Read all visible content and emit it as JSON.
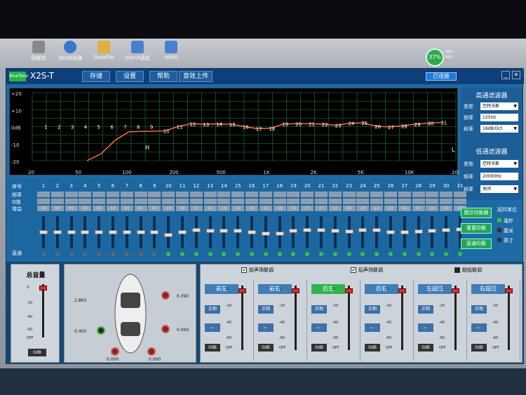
{
  "app": {
    "title": "X2S-T",
    "logo": "BlueTone",
    "connection": "已连接"
  },
  "menu": [
    "存储",
    "设置",
    "帮助",
    "音效上传"
  ],
  "desktop": {
    "icons": [
      "回收站",
      "360浏览器",
      "DataFile",
      "DSP-P调试",
      "H860"
    ],
    "battery": "37%",
    "net_up": "0K/s",
    "net_down": "0K/s"
  },
  "graph": {
    "y_labels": [
      "+20",
      "+10",
      "0dB",
      "-10",
      "-20"
    ],
    "x_labels": [
      "20",
      "50",
      "100",
      "200",
      "500",
      "1K",
      "2K",
      "5K",
      "10K",
      "20K"
    ],
    "marker_h": "H",
    "marker_l": "L"
  },
  "band_numbers": [
    "1",
    "2",
    "3",
    "4",
    "5",
    "6",
    "7",
    "8",
    "9",
    "10",
    "11",
    "12",
    "13",
    "14",
    "15",
    "16",
    "17",
    "18",
    "19",
    "20",
    "21",
    "22",
    "23",
    "24",
    "25",
    "26",
    "27",
    "28",
    "29",
    "30",
    "31"
  ],
  "band_gains": [
    0,
    0,
    0,
    0,
    0,
    0,
    0,
    0,
    0,
    -2.5,
    0.0,
    1.7,
    1.4,
    1.6,
    1.4,
    0.1,
    -1.2,
    -1.0,
    1.6,
    1.7,
    1.7,
    1.5,
    0.8,
    2.0,
    2.2,
    0.3,
    -0.2,
    0.5,
    1.5,
    2.0,
    2.5
  ],
  "rows": {
    "seq": "序号",
    "freq": "频率",
    "q": "Q值",
    "gain": "增益",
    "direct": "直通"
  },
  "high_filter": {
    "title": "高通滤波器",
    "type_label": "类型",
    "type": "巴特沃斯",
    "freq_label": "频率",
    "freq": "125Hz",
    "slope_label": "斜率",
    "slope": "18dB/Oct"
  },
  "low_filter": {
    "title": "低通滤波器",
    "type_label": "类型",
    "type": "巴特沃斯",
    "freq_label": "频率",
    "freq": "20000Hz",
    "slope_label": "斜率",
    "slope": "关闭"
  },
  "eq_buttons": [
    "图示均衡器",
    "重置均衡",
    "直通均衡"
  ],
  "delay": {
    "title": "延时单位",
    "units": [
      "毫秒",
      "厘米",
      "英寸"
    ]
  },
  "master": {
    "title": "总音量",
    "value": "0dB",
    "scale": [
      "0",
      "-20",
      "-40",
      "-60",
      "OFF"
    ]
  },
  "car": {
    "values": [
      "2.863",
      "0.390",
      "0.450",
      "0.000",
      "0.000",
      "0.000"
    ]
  },
  "link": {
    "front": "前声场联调",
    "rear": "后声场联调",
    "sub": "超低联调"
  },
  "channels": [
    {
      "name": "前左",
      "phase": "正相",
      "db": "0dB"
    },
    {
      "name": "前右",
      "phase": "正相",
      "db": "0dB"
    },
    {
      "name": "后左",
      "phase": "正相",
      "db": "0dB"
    },
    {
      "name": "后右",
      "phase": "正相",
      "db": "0dB"
    },
    {
      "name": "左超低",
      "phase": "正相",
      "db": "0dB"
    },
    {
      "name": "右超低",
      "phase": "正相",
      "db": "0dB"
    }
  ],
  "chan_scale": [
    "0",
    "-20",
    "-40",
    "-60",
    "OFF"
  ],
  "colors": {
    "curve": "#ff6a4a",
    "grid": "#1d8a2a",
    "active": "#3fbf3f",
    "sel": "#2fb34f"
  }
}
